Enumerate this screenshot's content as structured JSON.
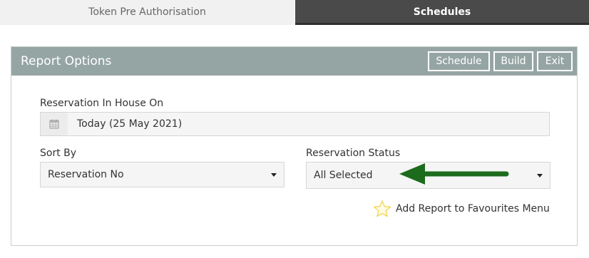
{
  "tabs": [
    {
      "label": "Token Pre Authorisation",
      "active": false
    },
    {
      "label": "Schedules",
      "active": true
    }
  ],
  "panel": {
    "title": "Report Options",
    "buttons": {
      "schedule": "Schedule",
      "build": "Build",
      "exit": "Exit"
    }
  },
  "form": {
    "in_house": {
      "label": "Reservation In House On",
      "value": "Today (25 May 2021)",
      "icon": "calendar-icon"
    },
    "sort_by": {
      "label": "Sort By",
      "value": "Reservation No"
    },
    "status": {
      "label": "Reservation Status",
      "value": "All Selected"
    },
    "favourites": {
      "label": "Add Report to Favourites Menu",
      "icon": "star-icon"
    }
  },
  "colors": {
    "header": "#95a5a3",
    "active_tab": "#4a4a4a",
    "arrow": "#1d6b1d",
    "star": "#f0d64a"
  }
}
